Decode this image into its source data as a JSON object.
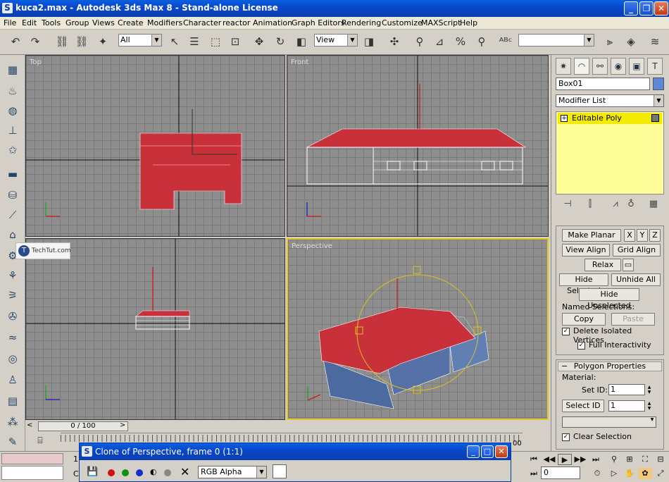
{
  "window": {
    "app_icon": "S",
    "title": "kuca2.max - Autodesk 3ds Max 8  - Stand-alone License",
    "minimize": "_",
    "maximize": "❐",
    "close": "✕"
  },
  "menu": [
    "File",
    "Edit",
    "Tools",
    "Group",
    "Views",
    "Create",
    "Modifiers",
    "Character",
    "reactor",
    "Animation",
    "Graph Editors",
    "Rendering",
    "Customize",
    "MAXScript",
    "Help"
  ],
  "toolbar": {
    "selection_filter": "All",
    "ref_coord": "View",
    "named_selection": ""
  },
  "viewports": {
    "top": "Top",
    "front": "Front",
    "left": "",
    "perspective": "Perspective"
  },
  "watermark": {
    "icon": "T",
    "text": "TechTut.com"
  },
  "command_panel": {
    "object_name": "Box01",
    "object_color": "#5b87d6",
    "modifier_list": "Modifier List",
    "stack_item": "Editable Poly",
    "stack_expand": "+",
    "buttons": {
      "make_planar": "Make Planar",
      "x": "X",
      "y": "Y",
      "z": "Z",
      "view_align": "View Align",
      "grid_align": "Grid Align",
      "relax": "Relax",
      "hide_selected": "Hide Selected",
      "unhide_all": "Unhide All",
      "hide_unselected": "Hide Unselected",
      "named_selections": "Named Selections:",
      "copy": "Copy",
      "paste": "Paste",
      "delete_isolated": "Delete Isolated Vertices",
      "full_interactivity": "Full Interactivity"
    },
    "polygon_properties": {
      "header": "Polygon Properties",
      "collapse": "−",
      "material": "Material:",
      "set_id_label": "Set ID:",
      "set_id_value": "1",
      "select_id": "Select ID",
      "select_id_value": "1",
      "clear_selection": "Clear Selection"
    }
  },
  "timeline": {
    "frame": "0 / 100",
    "tick_end": "00",
    "current_frame": "0"
  },
  "clone_window": {
    "title": "Clone of Perspective, frame 0 (1:1)",
    "channel": "RGB Alpha",
    "channel_dots": [
      "#d01010",
      "#109010",
      "#1030c8"
    ]
  },
  "status": {
    "line1": "1",
    "line2": "C"
  }
}
